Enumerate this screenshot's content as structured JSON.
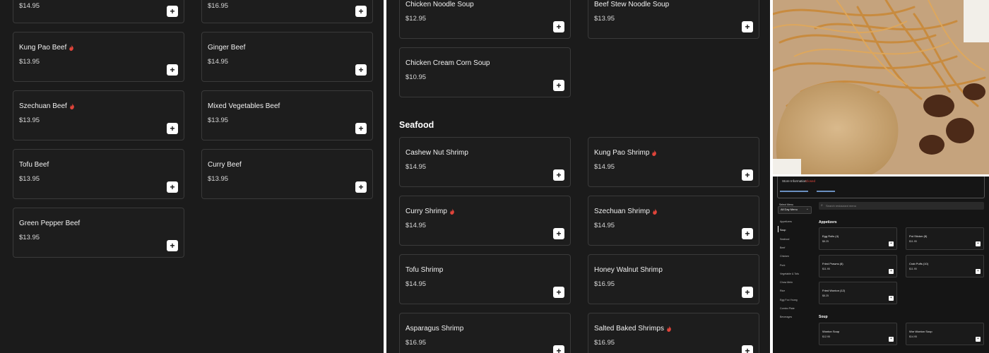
{
  "panel1": {
    "top_prices": [
      "$14.95",
      "$16.95"
    ],
    "items": [
      {
        "name": "Kung Pao Beef",
        "price": "$13.95",
        "spicy": true
      },
      {
        "name": "Ginger Beef",
        "price": "$14.95",
        "spicy": false
      },
      {
        "name": "Szechuan Beef",
        "price": "$13.95",
        "spicy": true
      },
      {
        "name": "Mixed Vegetables Beef",
        "price": "$13.95",
        "spicy": false
      },
      {
        "name": "Tofu Beef",
        "price": "$13.95",
        "spicy": false
      },
      {
        "name": "Curry Beef",
        "price": "$13.95",
        "spicy": false
      },
      {
        "name": "Green Pepper Beef",
        "price": "$13.95",
        "spicy": false
      }
    ]
  },
  "panel2": {
    "soup_items": [
      {
        "name": "Chicken Noodle Soup",
        "price": "$12.95",
        "spicy": false
      },
      {
        "name": "Beef Stew Noodle Soup",
        "price": "$13.95",
        "spicy": false
      },
      {
        "name": "Chicken Cream Corn Soup",
        "price": "$10.95",
        "spicy": false
      }
    ],
    "seafood_title": "Seafood",
    "seafood_items": [
      {
        "name": "Cashew Nut Shrimp",
        "price": "$14.95",
        "spicy": false
      },
      {
        "name": "Kung Pao Shrimp",
        "price": "$14.95",
        "spicy": true
      },
      {
        "name": "Curry Shrimp",
        "price": "$14.95",
        "spicy": true
      },
      {
        "name": "Szechuan Shrimp",
        "price": "$14.95",
        "spicy": true
      },
      {
        "name": "Tofu Shrimp",
        "price": "$14.95",
        "spicy": false
      },
      {
        "name": "Honey Walnut Shrimp",
        "price": "$16.95",
        "spicy": false
      },
      {
        "name": "Asparagus Shrimp",
        "price": "$16.95",
        "spicy": false
      },
      {
        "name": "Salted Baked Shrimps",
        "price": "$16.95",
        "spicy": true
      }
    ]
  },
  "add_label": "+",
  "mini": {
    "store_info": "Store Information",
    "closed_badge": "Closed",
    "select_menu_label": "Select Menu",
    "select_menu_value": "All Day Menu",
    "search_placeholder": "Search restaurant menu",
    "sidebar": [
      "Appetizers",
      "Soup",
      "Seafood",
      "Beef",
      "Chicken",
      "Pork",
      "Vegetable & Tofu",
      "Chow Mein",
      "Rice",
      "Egg Foo Young",
      "Combo Plate",
      "Beverages"
    ],
    "appetizers_title": "Appetizers",
    "appetizers": [
      {
        "name": "Egg Rolls (4)",
        "price": "$8.25"
      },
      {
        "name": "Pot Sticker (8)",
        "price": "$11.95"
      },
      {
        "name": "Fried Prawns (8)",
        "price": "$11.95"
      },
      {
        "name": "Crab Puffs (10)",
        "price": "$11.95"
      },
      {
        "name": "Fried Wonton (12)",
        "price": "$8.25"
      }
    ],
    "soup_title": "Soup",
    "soup": [
      {
        "name": "Wonton Soup",
        "price": "$12.95"
      },
      {
        "name": "Wor Wonton Soup",
        "price": "$14.95"
      }
    ]
  },
  "colors": {
    "background": "#1b1b1b",
    "card_border": "#3a3a3a",
    "spicy": "#e0443a",
    "add_button": "#ffffff"
  }
}
